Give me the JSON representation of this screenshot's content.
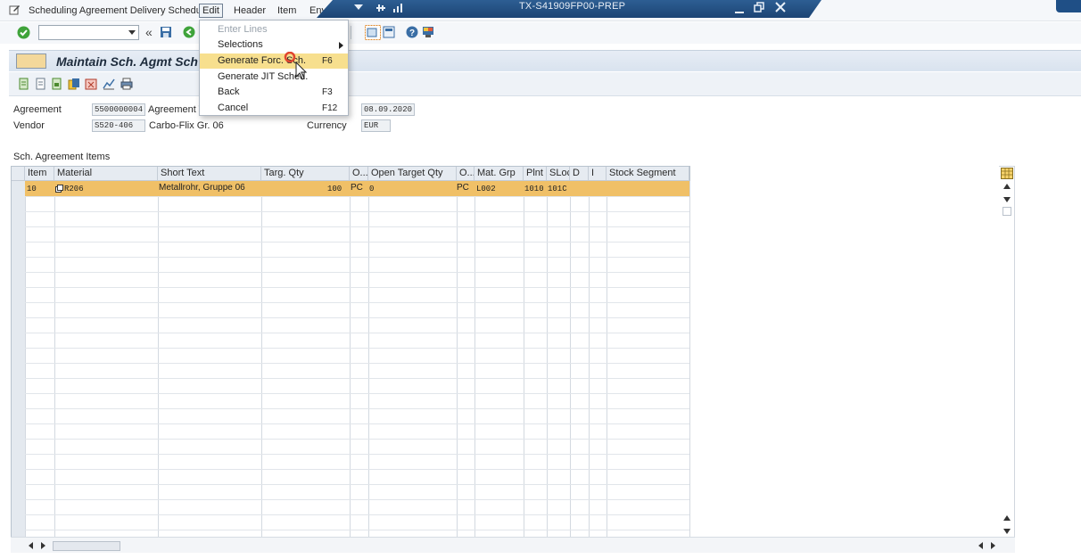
{
  "menubar": {
    "title": "Scheduling Agreement Delivery Schedule",
    "items": [
      "Edit",
      "Header",
      "Item",
      "Env"
    ]
  },
  "window": {
    "title": "TX-S41909FP00-PREP"
  },
  "edit_menu": {
    "items": [
      {
        "label": "Enter Lines",
        "shortcut": "",
        "state": "disabled"
      },
      {
        "label": "Selections",
        "shortcut": "",
        "state": "submenu"
      },
      {
        "label": "Generate Forc. Sch.",
        "shortcut": "F6",
        "state": "highlighted"
      },
      {
        "label": "Generate JIT Sched.",
        "shortcut": "",
        "state": "normal"
      },
      {
        "label": "Back",
        "shortcut": "F3",
        "state": "normal"
      },
      {
        "label": "Cancel",
        "shortcut": "F12",
        "state": "normal"
      }
    ]
  },
  "page": {
    "title": "Maintain Sch. Agmt Sch"
  },
  "form": {
    "agreement_label": "Agreement",
    "agreement_value": "5500000004",
    "agreement_type_label": "Agreement T",
    "date_value": "08.09.2020",
    "vendor_label": "Vendor",
    "vendor_value": "S520-406",
    "vendor_name": "Carbo-Flix Gr. 06",
    "currency_label": "Currency",
    "currency_value": "EUR"
  },
  "table": {
    "section_title": "Sch. Agreement Items",
    "columns": [
      "Item",
      "Material",
      "Short Text",
      "Targ. Qty",
      "O...",
      "Open Target Qty",
      "O...",
      "Mat. Grp",
      "Plnt",
      "SLoc",
      "D",
      "I",
      "Stock Segment"
    ],
    "rows": [
      {
        "item": "10",
        "material": "R206",
        "short_text": "Metallrohr, Gruppe 06",
        "targ_qty": "100",
        "unit": "PC",
        "open_target_qty": "0",
        "unit2": "PC",
        "mat_grp": "L002",
        "plnt": "1010",
        "sloc": "101C",
        "d": "",
        "i": "",
        "stock_segment": ""
      }
    ]
  },
  "colors": {
    "selected_row": "#f0c067",
    "menu_highlight": "#f7df8e",
    "title_bar": "#1c4474"
  }
}
